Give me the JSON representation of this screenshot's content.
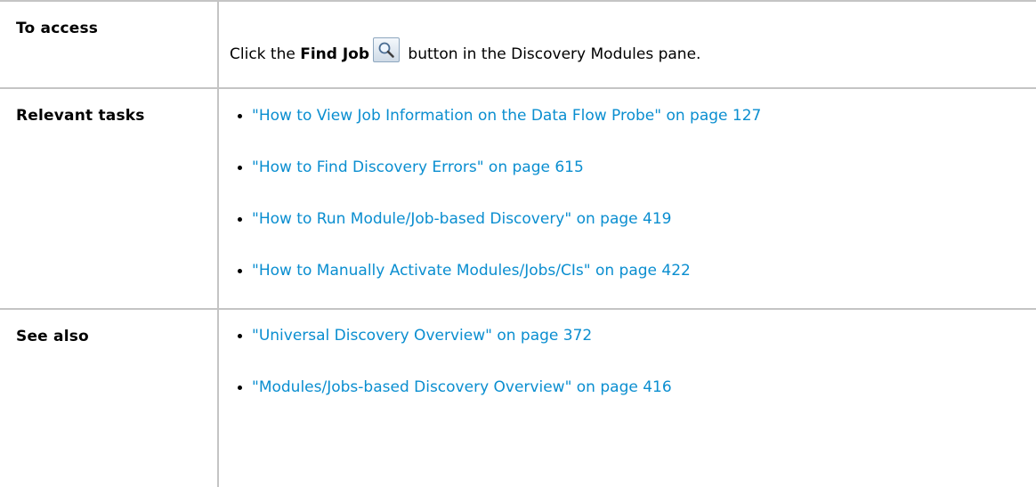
{
  "rows": {
    "access": {
      "heading": "To access",
      "prefix": "Click the ",
      "bold_text": "Find Job",
      "button_icon": "magnifier-icon",
      "suffix": " button in the Discovery Modules pane."
    },
    "tasks": {
      "heading": "Relevant tasks",
      "links": [
        "\"How to View Job Information on the Data Flow Probe\" on page 127",
        "\"How to Find Discovery Errors\" on page 615",
        "\"How to Run Module/Job-based Discovery\" on page 419",
        "\"How to Manually Activate Modules/Jobs/CIs\" on page 422"
      ]
    },
    "see_also": {
      "heading": "See also",
      "links": [
        "\"Universal Discovery Overview\" on page 372",
        "\"Modules/Jobs-based Discovery Overview\" on page 416"
      ]
    }
  },
  "colors": {
    "link": "#0a8ed0",
    "border": "#c4c4c4"
  }
}
